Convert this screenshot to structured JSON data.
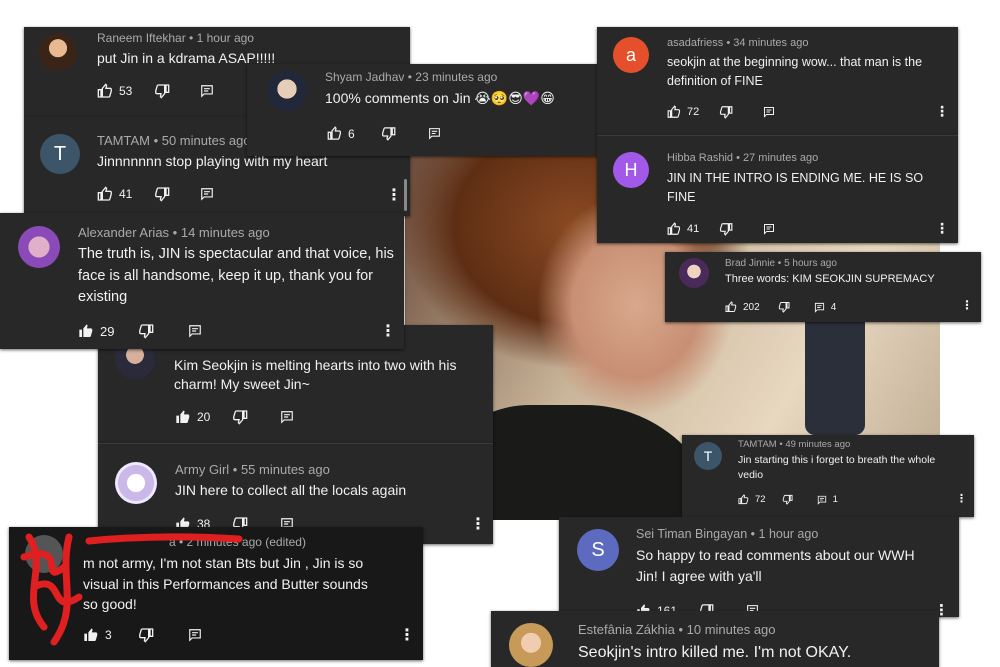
{
  "comments": {
    "c1": {
      "author": "Raneem Iftekhar",
      "time": "1 hour ago",
      "text": "put Jin in a kdrama ASAP!!!!!",
      "likes": "53"
    },
    "c2": {
      "author": "Shyam Jadhav",
      "time": "23 minutes ago",
      "text": "100% comments on Jin 😭🥺😎💜😁",
      "likes": "6"
    },
    "c3": {
      "author": "asadafriess",
      "initial": "a",
      "time": "34 minutes ago",
      "text": "seokjin at the beginning wow... that man is the definition of FINE",
      "likes": "72"
    },
    "c4": {
      "author": "TAMTAM",
      "initial": "T",
      "time": "50 minutes ago",
      "text": "Jinnnnnnn stop playing with my heart",
      "likes": "41"
    },
    "c5": {
      "author": "Hibba Rashid",
      "initial": "H",
      "time": "27 minutes ago",
      "text": "JIN IN THE INTRO IS ENDING ME. HE IS SO FINE",
      "likes": "41"
    },
    "c6": {
      "author": "Alexander Arias",
      "time": "14 minutes ago",
      "text": "The truth is, JIN is spectacular and that voice, his face is all handsome, keep it up, thank you for existing",
      "likes": "29"
    },
    "c7": {
      "author": "Brad Jinnie",
      "time": "5 hours ago",
      "text": "Three words: KIM SEOKJIN SUPREMACY",
      "likes": "202",
      "replies": "4"
    },
    "c8": {
      "text": "Kim Seokjin is melting hearts into two with his charm! My sweet Jin~",
      "likes": "20"
    },
    "c9": {
      "author": "TAMTAM",
      "initial": "T",
      "time": "49 minutes ago",
      "text": "Jin starting this i forget to breath the whole vedio",
      "likes": "72",
      "replies": "1"
    },
    "c10": {
      "author": "Army Girl",
      "time": "55 minutes ago",
      "text": "JIN here to collect all the locals again",
      "likes": "38"
    },
    "c11": {
      "time_fragment": "a • 2 minutes ago (edited)",
      "text": "m not army, I'm not stan Bts but Jin , Jin is so visual in this Performances and Butter sounds so good!",
      "likes": "3"
    },
    "c12": {
      "author": "Sei Timan Bingayan",
      "initial": "S",
      "time": "1 hour ago",
      "text": "So happy to read comments about our WWH Jin! I agree with ya'll",
      "likes": "161"
    },
    "c13": {
      "author": "Estefânia Zákhia",
      "time": "10 minutes ago",
      "text": "Seokjin's intro killed me. I'm not OKAY."
    }
  },
  "sep": " • ",
  "colors": {
    "card": "#282828",
    "card_dark": "#181818",
    "meta": "#aaaaaa",
    "text": "#f1f1f1",
    "av_red": "#e5502c",
    "av_purple": "#a259e8",
    "av_slate": "#3d5568",
    "av_indigo": "#5c6bc0",
    "scribble": "#e02020"
  }
}
